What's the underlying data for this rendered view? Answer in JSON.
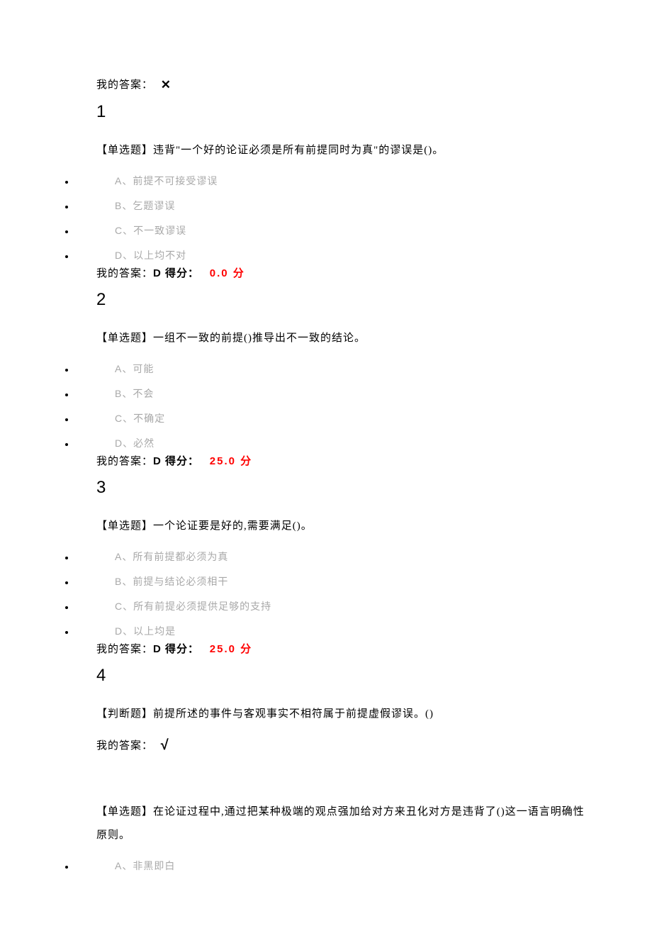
{
  "labels": {
    "my_answer_prefix": "我的答案：",
    "score_suffix_label": " 得分：",
    "score_unit": " 分"
  },
  "intro_answer": {
    "mark": "✕"
  },
  "questions": [
    {
      "number": "1",
      "type_tag": "【单选题】",
      "text": "违背\"一个好的论证必须是所有前提同时为真\"的谬误是()。",
      "options": [
        {
          "letter": "A、",
          "text": "前提不可接受谬误"
        },
        {
          "letter": "B、",
          "text": "乞题谬误"
        },
        {
          "letter": "C、",
          "text": "不一致谬误"
        },
        {
          "letter": "D、",
          "text": "以上均不对"
        }
      ],
      "my_answer": "D",
      "score": "0.0"
    },
    {
      "number": "2",
      "type_tag": "【单选题】",
      "text": "一组不一致的前提()推导出不一致的结论。",
      "options": [
        {
          "letter": "A、",
          "text": "可能"
        },
        {
          "letter": "B、",
          "text": "不会"
        },
        {
          "letter": "C、",
          "text": "不确定"
        },
        {
          "letter": "D、",
          "text": "必然"
        }
      ],
      "my_answer": "D",
      "score": "25.0"
    },
    {
      "number": "3",
      "type_tag": "【单选题】",
      "text": "一个论证要是好的,需要满足()。",
      "options": [
        {
          "letter": "A、",
          "text": "所有前提都必须为真"
        },
        {
          "letter": "B、",
          "text": "前提与结论必须相干"
        },
        {
          "letter": "C、",
          "text": "所有前提必须提供足够的支持"
        },
        {
          "letter": "D、",
          "text": "以上均是"
        }
      ],
      "my_answer": "D",
      "score": "25.0"
    },
    {
      "number": "4",
      "type_tag": "【判断题】",
      "text": "前提所述的事件与客观事实不相符属于前提虚假谬误。()",
      "my_answer_mark": "√"
    },
    {
      "number": "",
      "type_tag": "【单选题】",
      "text": "在论证过程中,通过把某种极端的观点强加给对方来丑化对方是违背了()这一语言明确性原则。",
      "options_partial": [
        {
          "letter": "A、",
          "text": "非黑即白"
        }
      ]
    }
  ]
}
